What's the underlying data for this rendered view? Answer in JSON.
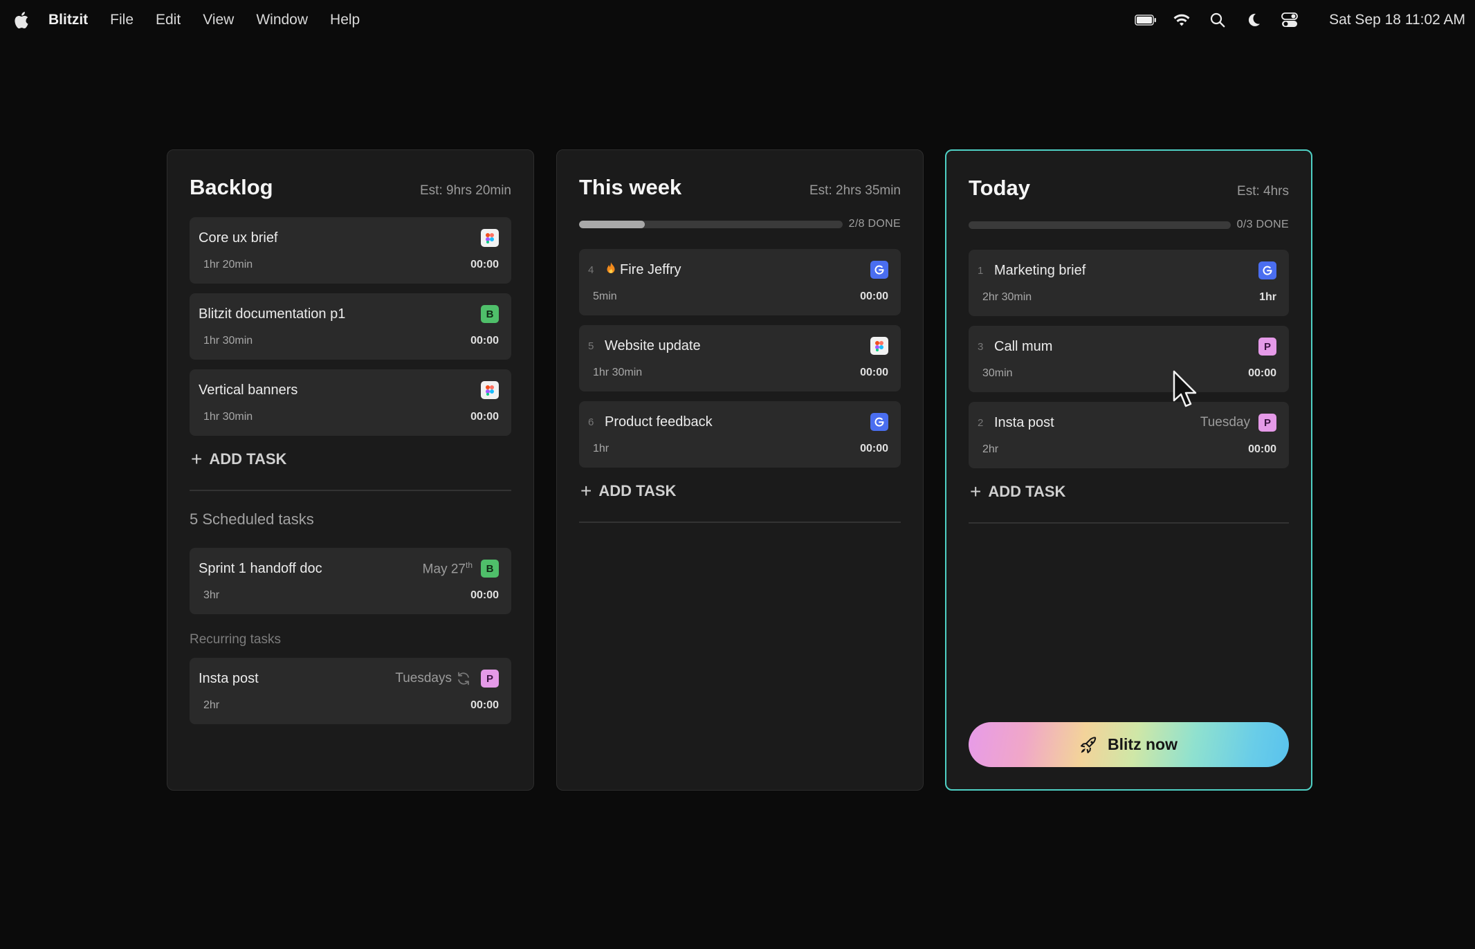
{
  "menubar": {
    "app_name": "Blitzit",
    "items": [
      "File",
      "Edit",
      "View",
      "Window",
      "Help"
    ],
    "clock": "Sat Sep 18  11:02 AM",
    "icons": [
      "battery-icon",
      "wifi-icon",
      "search-icon",
      "moon-icon",
      "control-center-icon"
    ]
  },
  "backlog": {
    "title": "Backlog",
    "estimate": "Est: 9hrs 20min",
    "tasks": [
      {
        "title": "Core ux brief",
        "duration": "1hr 20min",
        "time": "00:00",
        "badge": "figma"
      },
      {
        "title": "Blitzit documentation p1",
        "duration": "1hr 30min",
        "time": "00:00",
        "badge": "B"
      },
      {
        "title": "Vertical banners",
        "duration": "1hr 30min",
        "time": "00:00",
        "badge": "figma"
      }
    ],
    "add_task": "ADD TASK",
    "scheduled_label": "5 Scheduled tasks",
    "scheduled": [
      {
        "title": "Sprint 1 handoff doc",
        "when": "May 27",
        "when_suffix": "th",
        "duration": "3hr",
        "time": "00:00",
        "badge": "B"
      }
    ],
    "recurring_label": "Recurring tasks",
    "recurring": [
      {
        "title": "Insta post",
        "when": "Tuesdays",
        "duration": "2hr",
        "time": "00:00",
        "badge": "P"
      }
    ]
  },
  "this_week": {
    "title": "This week",
    "estimate": "Est: 2hrs 35min",
    "progress": {
      "done": 2,
      "total": 8,
      "label": "2/8 DONE"
    },
    "tasks": [
      {
        "num": "4",
        "title": "Fire Jeffry",
        "duration": "5min",
        "time": "00:00",
        "badge": "G"
      },
      {
        "num": "5",
        "title": "Website update",
        "duration": "1hr 30min",
        "time": "00:00",
        "badge": "figma"
      },
      {
        "num": "6",
        "title": "Product feedback",
        "duration": "1hr",
        "time": "00:00",
        "badge": "G"
      }
    ],
    "add_task": "ADD TASK"
  },
  "today": {
    "title": "Today",
    "estimate": "Est: 4hrs",
    "progress": {
      "done": 0,
      "total": 3,
      "label": "0/3 DONE"
    },
    "tasks": [
      {
        "num": "1",
        "title": "Marketing brief",
        "duration": "2hr 30min",
        "time": "1hr",
        "badge": "G"
      },
      {
        "num": "3",
        "title": "Call mum",
        "duration": "30min",
        "time": "00:00",
        "badge": "P"
      },
      {
        "num": "2",
        "title": "Insta post",
        "when": "Tuesday",
        "duration": "2hr",
        "time": "00:00",
        "badge": "P"
      }
    ],
    "add_task": "ADD TASK",
    "blitz_label": "Blitz now"
  },
  "colors": {
    "background": "#0b0b0b",
    "column": "#1b1b1b",
    "card": "#2a2a2a",
    "today_border": "#4fd1c5",
    "badge_b": "#4fbf6a",
    "badge_p": "#e59ae8",
    "badge_g": "#4a6ef0"
  }
}
